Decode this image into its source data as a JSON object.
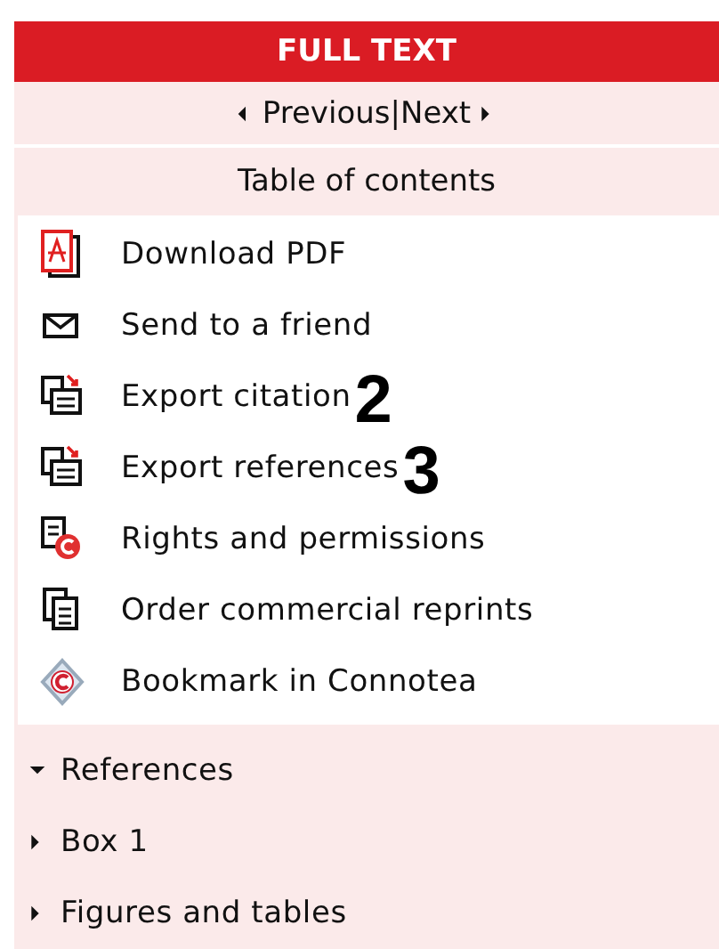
{
  "header": {
    "title": "FULL TEXT"
  },
  "navigation": {
    "previous": "Previous",
    "separator": "|",
    "next": "Next"
  },
  "toc_link": "Table of contents",
  "links": [
    {
      "kind": "pdf",
      "label": "Download PDF"
    },
    {
      "kind": "mail",
      "label": "Send to a friend"
    },
    {
      "kind": "export",
      "label": "Export citation",
      "annotation": "2"
    },
    {
      "kind": "export",
      "label": "Export references",
      "annotation": "3"
    },
    {
      "kind": "rights",
      "label": "Rights and permissions"
    },
    {
      "kind": "reprints",
      "label": "Order commercial reprints"
    },
    {
      "kind": "bookmark",
      "label": "Bookmark in Connotea"
    }
  ],
  "sections": [
    {
      "label": "References",
      "expanded": true
    },
    {
      "label": "Box 1",
      "expanded": false
    },
    {
      "label": "Figures and tables",
      "expanded": false
    }
  ]
}
